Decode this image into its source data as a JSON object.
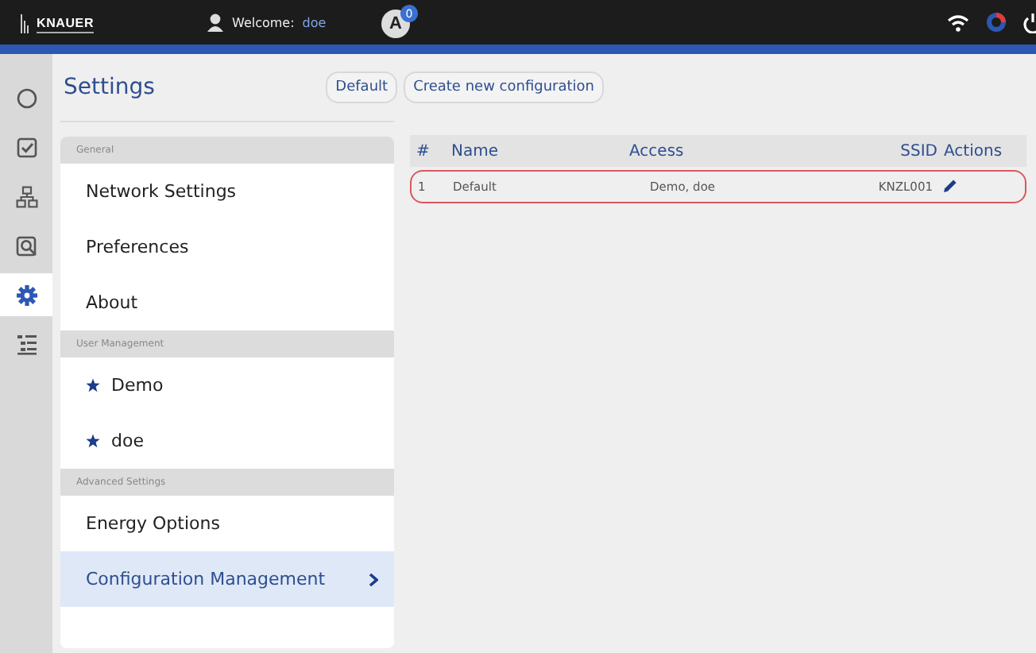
{
  "top_bar": {
    "logo": "KNAUER",
    "welcome_label": "Welcome:",
    "user": "doe",
    "status_letter": "A",
    "notification_count": "0"
  },
  "rail": [
    {
      "kind": "circle",
      "selected": false
    },
    {
      "kind": "check",
      "selected": false
    },
    {
      "kind": "network",
      "selected": false
    },
    {
      "kind": "search",
      "selected": false
    },
    {
      "kind": "gear",
      "selected": true
    },
    {
      "kind": "list",
      "selected": false
    }
  ],
  "settings": {
    "title": "Settings",
    "buttons": [
      "Default",
      "Create new configuration"
    ],
    "sections": [
      {
        "header": "General",
        "items": [
          {
            "label": "Network Settings",
            "starred": false,
            "selected": false
          },
          {
            "label": "Preferences",
            "starred": false,
            "selected": false
          },
          {
            "label": "About",
            "starred": false,
            "selected": false
          }
        ]
      },
      {
        "header": "User Management",
        "items": [
          {
            "label": "Demo",
            "starred": true,
            "selected": false
          },
          {
            "label": "doe",
            "starred": true,
            "selected": false
          }
        ]
      },
      {
        "header": "Advanced Settings",
        "items": [
          {
            "label": "Energy Options",
            "starred": false,
            "selected": false
          },
          {
            "label": "Configuration Management",
            "starred": false,
            "selected": true
          }
        ]
      }
    ]
  },
  "table": {
    "columns": [
      "#",
      "Name",
      "Access",
      "SSID",
      "Actions"
    ],
    "rows": [
      {
        "cells": [
          "1",
          "Default",
          "Demo, doe",
          "KNZL001"
        ],
        "selected": true
      }
    ]
  }
}
